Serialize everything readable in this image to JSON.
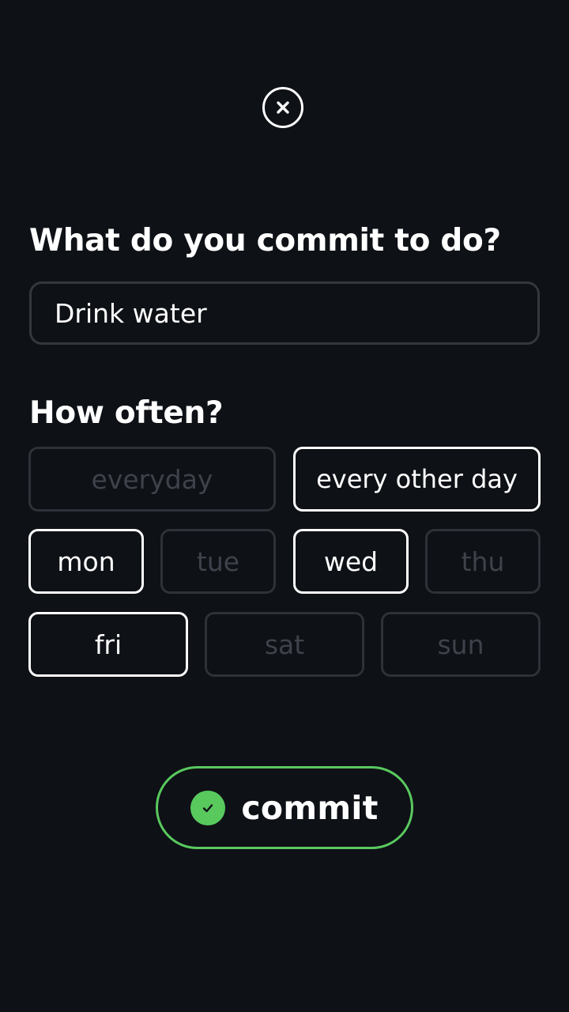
{
  "close": {
    "icon": "close-icon"
  },
  "commit_question": {
    "title": "What do you commit to do?"
  },
  "habit_input": {
    "value": "Drink water"
  },
  "frequency": {
    "title": "How often?",
    "options": [
      {
        "label": "everyday",
        "selected": false
      },
      {
        "label": "every other day",
        "selected": true
      }
    ],
    "days": [
      {
        "label": "mon",
        "selected": true
      },
      {
        "label": "tue",
        "selected": false
      },
      {
        "label": "wed",
        "selected": true
      },
      {
        "label": "thu",
        "selected": false
      },
      {
        "label": "fri",
        "selected": true
      },
      {
        "label": "sat",
        "selected": false
      },
      {
        "label": "sun",
        "selected": false
      }
    ]
  },
  "commit_button": {
    "label": "commit",
    "icon": "check-circle-icon"
  },
  "colors": {
    "background": "#0e1116",
    "accent": "#59c95e",
    "text": "#ffffff",
    "border_inactive": "#2e3138",
    "text_inactive": "#3e424a"
  }
}
